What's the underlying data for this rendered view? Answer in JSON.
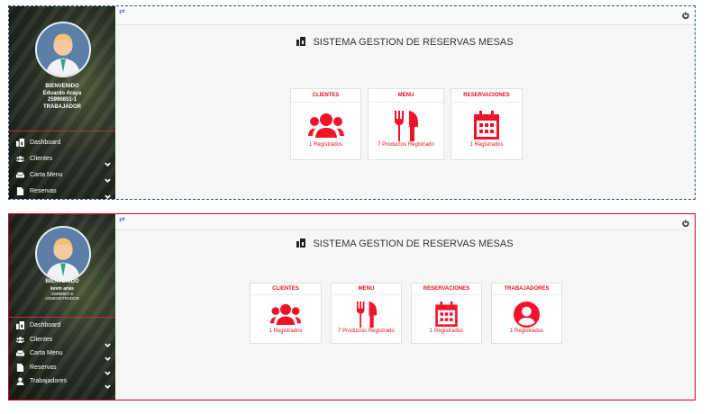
{
  "panel_top": {
    "user": {
      "greeting": "BIENVENIDO",
      "name": "Eduardo Araya",
      "rut": "25996851-1",
      "role": "TRABAJADOR"
    },
    "menu": [
      {
        "label": "Dashboard",
        "icon": "dashboard-icon",
        "has_submenu": false
      },
      {
        "label": "Clientes",
        "icon": "users-icon",
        "has_submenu": true
      },
      {
        "label": "Carta Menu",
        "icon": "couch-icon",
        "has_submenu": true
      },
      {
        "label": "Reservas",
        "icon": "file-icon",
        "has_submenu": true
      }
    ],
    "title": "SISTEMA GESTION DE RESERVAS MESAS",
    "cards": [
      {
        "header": "CLIENTES",
        "count": "1 Registrados",
        "icon": "users-icon"
      },
      {
        "header": "MENU",
        "count": "7 Productos Registrado",
        "icon": "utensils-icon"
      },
      {
        "header": "RESERVACIONES",
        "count": "1 Registrados",
        "icon": "calendar-icon"
      }
    ]
  },
  "panel_bottom": {
    "user": {
      "greeting": "BIENVENIDO",
      "name": "kevin arias",
      "rut": "25996657-6",
      "role": "ADMINISTRADOR"
    },
    "menu": [
      {
        "label": "Dashboard",
        "icon": "dashboard-icon",
        "has_submenu": false
      },
      {
        "label": "Clientes",
        "icon": "users-icon",
        "has_submenu": true
      },
      {
        "label": "Carta Menu",
        "icon": "couch-icon",
        "has_submenu": true
      },
      {
        "label": "Reservas",
        "icon": "file-icon",
        "has_submenu": true
      },
      {
        "label": "Trabajadores",
        "icon": "user-icon",
        "has_submenu": true
      }
    ],
    "title": "SISTEMA GESTION DE RESERVAS MESAS",
    "cards": [
      {
        "header": "CLIENTES",
        "count": "1 Registrados",
        "icon": "users-icon"
      },
      {
        "header": "MENU",
        "count": "7 Productos Registrado",
        "icon": "utensils-icon"
      },
      {
        "header": "RESERVACIONES",
        "count": "1 Registrados",
        "icon": "calendar-icon"
      },
      {
        "header": "TRABAJADORES",
        "count": "1 Registrados",
        "icon": "user-circle-icon"
      }
    ]
  },
  "colors": {
    "accent": "#e8101e",
    "sidebar": "#2b3326",
    "top_border": "#2f4f8f",
    "bottom_border": "#d0021b"
  },
  "topbar_icons": [
    "swap-icon",
    "power-icon"
  ]
}
